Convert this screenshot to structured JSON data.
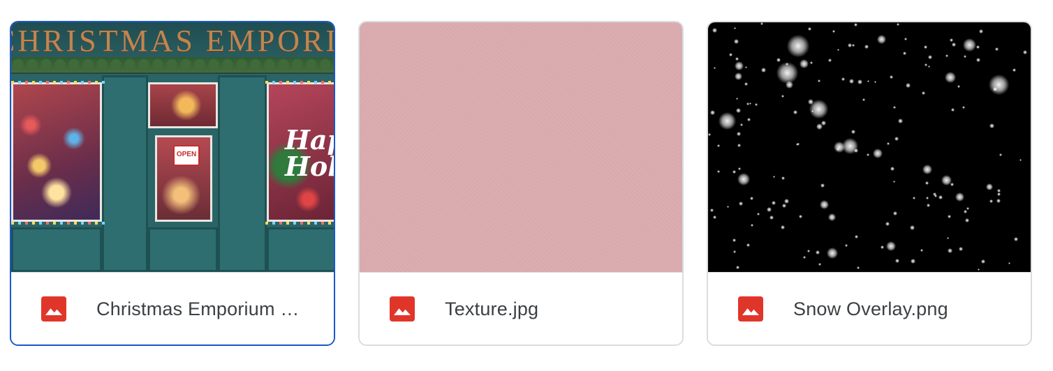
{
  "files": [
    {
      "name": "Christmas Emporium …",
      "selected": true,
      "icon": "image-file-icon",
      "thumbnail": {
        "sign_text": "CHRISTMAS EMPORIUM",
        "open_sign": "OPEN",
        "window_text": "Happy Holidays"
      }
    },
    {
      "name": "Texture.jpg",
      "selected": false,
      "icon": "image-file-icon",
      "thumbnail_color": "#dbacaf"
    },
    {
      "name": "Snow Overlay.png",
      "selected": false,
      "icon": "image-file-icon",
      "thumbnail_color": "#000000"
    }
  ],
  "colors": {
    "selected_border": "#1a57c8",
    "card_border": "#dadce0",
    "image_icon": "#e0362a",
    "file_name_text": "#3c4043"
  }
}
